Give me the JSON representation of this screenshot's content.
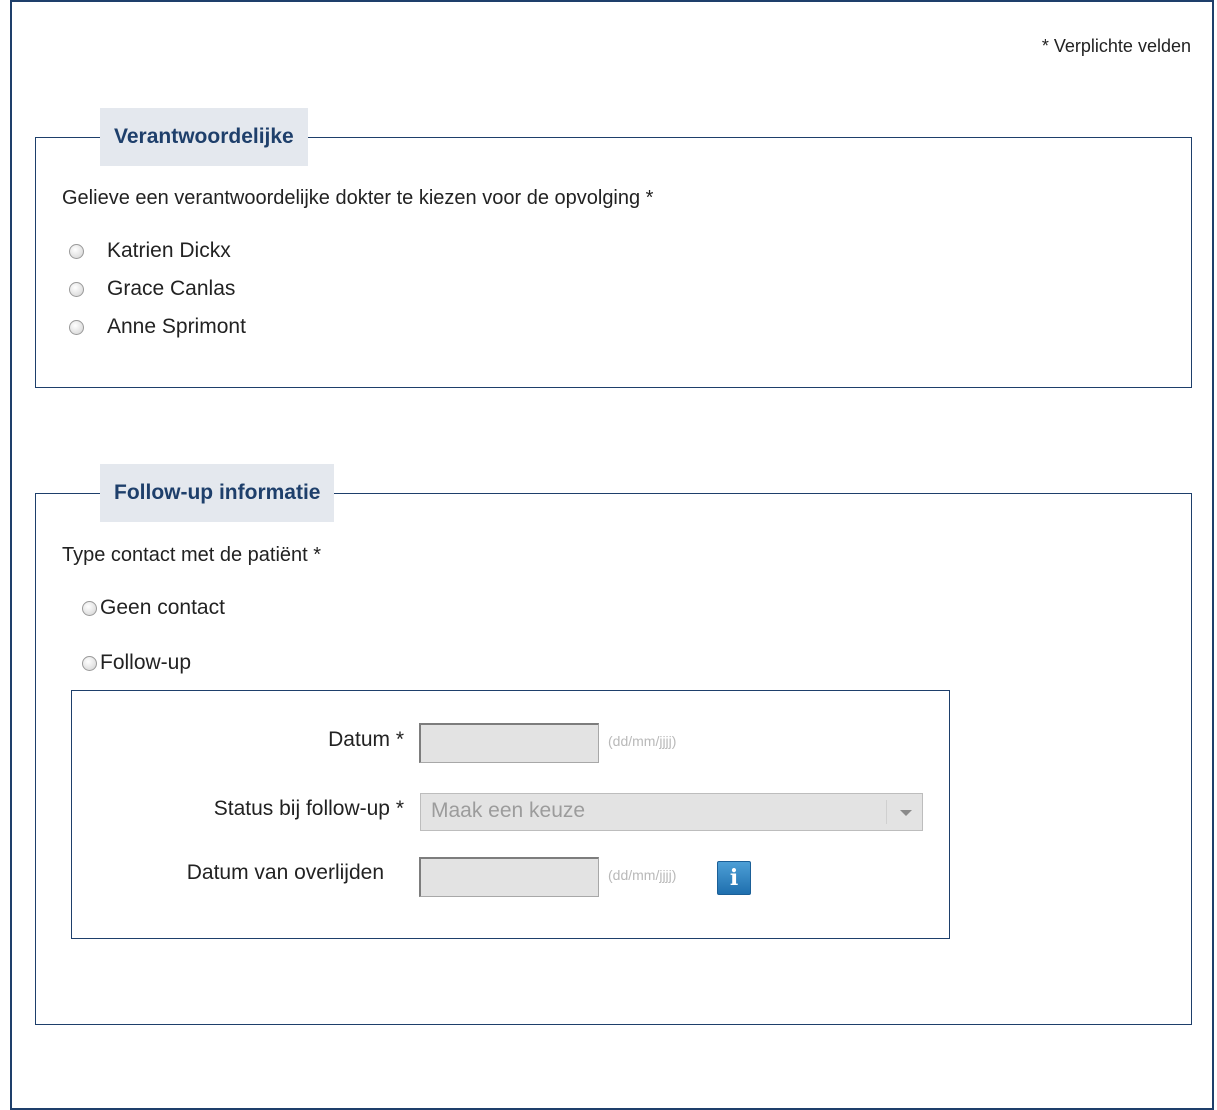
{
  "required_note": "* Verplichte velden",
  "section_verantwoordelijke": {
    "legend": "Verantwoordelijke",
    "question": "Gelieve een verantwoordelijke dokter te kiezen voor de opvolging *",
    "options": [
      "Katrien Dickx",
      "Grace Canlas",
      "Anne Sprimont"
    ]
  },
  "section_followup": {
    "legend": "Follow-up informatie",
    "question": "Type contact met de patiënt *",
    "options": [
      "Geen contact",
      "Follow-up"
    ],
    "fields": {
      "datum_label": "Datum *",
      "datum_value": "",
      "datum_hint": "(dd/mm/jjjj)",
      "status_label": "Status bij follow-up *",
      "status_selected": "Maak een keuze",
      "overlijden_label": "Datum van overlijden",
      "overlijden_value": "",
      "overlijden_hint": "(dd/mm/jjjj)",
      "info_icon": "i"
    }
  },
  "colors": {
    "accent": "#1e3f6b",
    "legend_bg": "#e4e8ee",
    "disabled_input_bg": "#e3e3e3",
    "info_blue": "#2a7fc0"
  }
}
